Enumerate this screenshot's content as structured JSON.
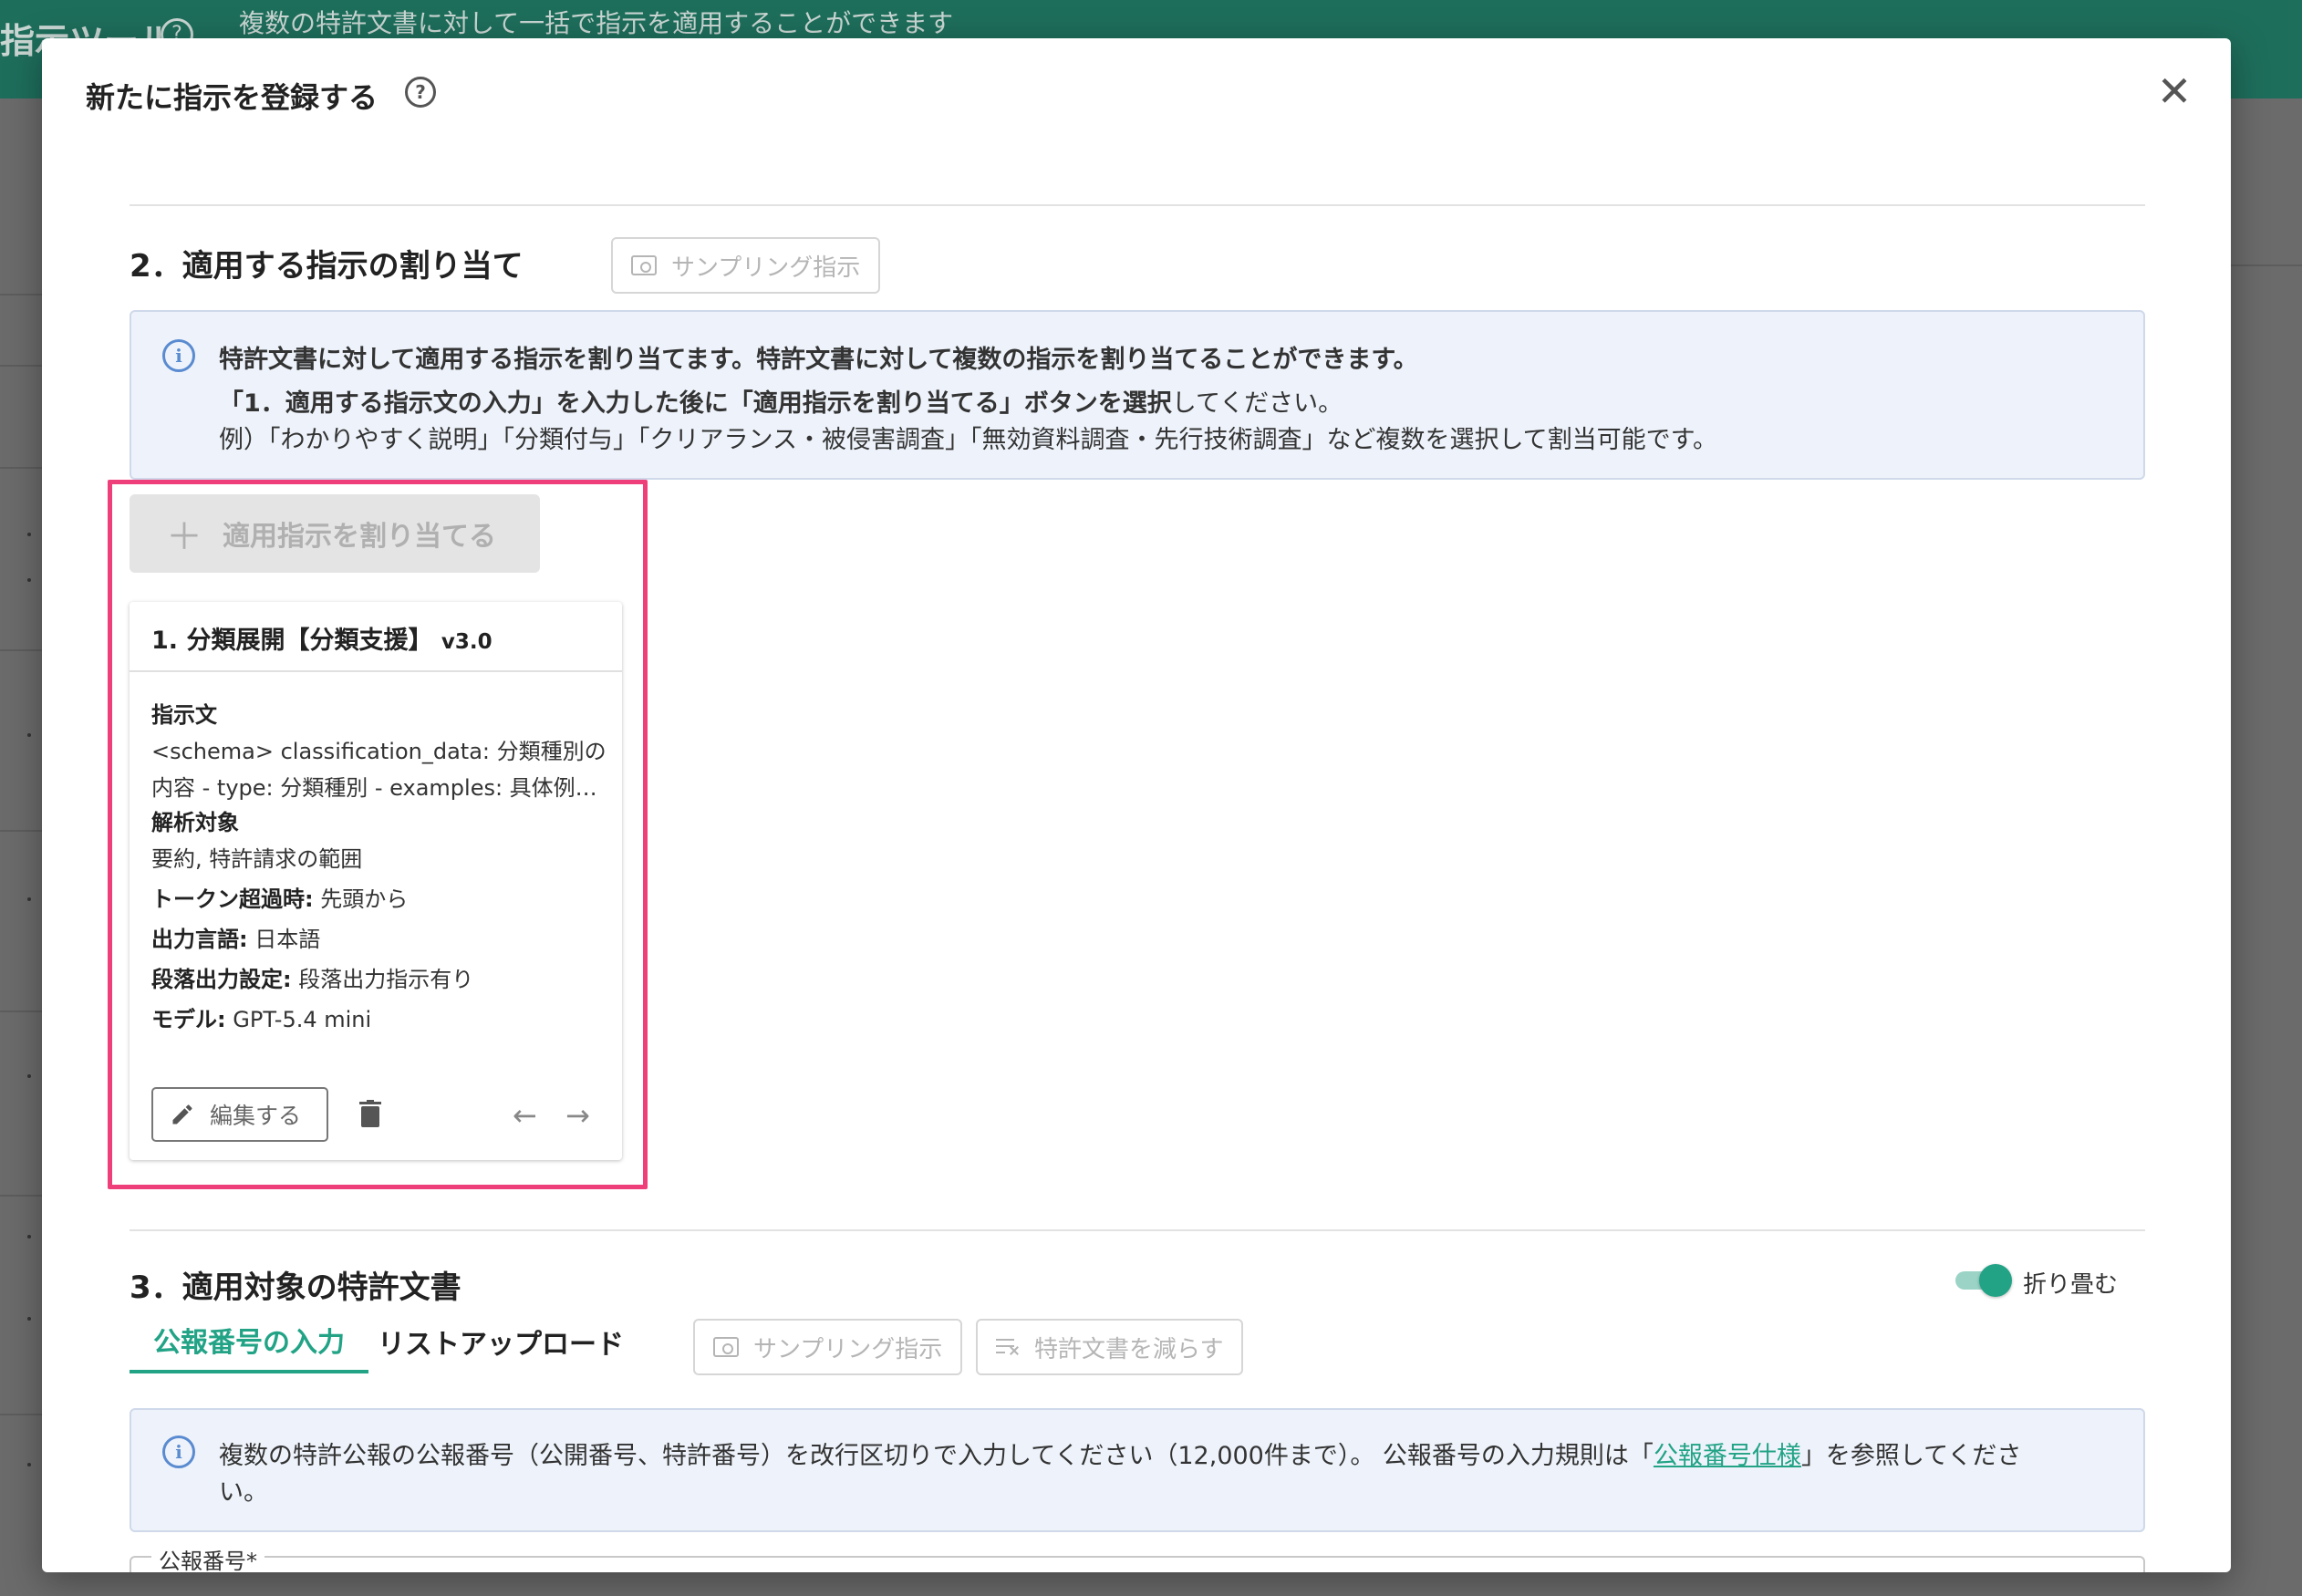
{
  "background": {
    "app_title": "指示ツール",
    "subtitle": "複数の特許文書に対して一括で指示を適用することができます"
  },
  "modal": {
    "title": "新たに指示を登録する",
    "close_symbol": "✕"
  },
  "section2": {
    "title": "2．適用する指示の割り当て",
    "sampling_button": "サンプリング指示",
    "info_lines": [
      "特許文書に対して適用する指示を割り当てます。特許文書に対して複数の指示を割り当てることができます。",
      "「1．適用する指示文の入力」を入力した後に「適用指示を割り当てる」ボタンを選択",
      "してください。",
      "例）「わかりやすく説明」「分類付与」「クリアランス・被侵害調査」「無効資料調査・先行技術調査」など複数を選択して割当可能です。"
    ],
    "assign_button": "適用指示を割り当てる",
    "card": {
      "title": "1. 分類展開【分類支援】",
      "version": "v3.0",
      "instruction_label": "指示文",
      "instruction_line1": "<schema> classification_data: 分類種別の",
      "instruction_line2": "内容 - type: 分類種別 - examples: 具体例…",
      "target_label": "解析対象",
      "target_value": "要約, 特許請求の範囲",
      "token_label": "トークン超過時:",
      "token_value": "先頭から",
      "lang_label": "出力言語:",
      "lang_value": "日本語",
      "para_label": "段落出力設定:",
      "para_value": "段落出力指示有り",
      "model_label": "モデル:",
      "model_value": "GPT-5.4 mini",
      "edit_button": "編集する"
    }
  },
  "section3": {
    "title": "3．適用対象の特許文書",
    "collapse_label": "折り畳む",
    "collapse_on": true,
    "tabs": [
      {
        "label": "公報番号の入力",
        "active": true
      },
      {
        "label": "リストアップロード",
        "active": false
      }
    ],
    "sampling_button": "サンプリング指示",
    "reduce_button": "特許文書を減らす",
    "info_line1_pre": "複数の特許公報の公報番号（公開番号、特許番号）を改行区切りで入力してください（12,000件まで）。 公報番号の入力規則は「",
    "info_link": "公報番号仕様",
    "info_line1_post": "」を参照してくださ",
    "info_line2": "い。",
    "field_label": "公報番号*"
  },
  "colors": {
    "accent": "#22a386",
    "header": "#1e6e5c",
    "highlight": "#ef3f7b",
    "info_bg": "#eef3fb"
  }
}
